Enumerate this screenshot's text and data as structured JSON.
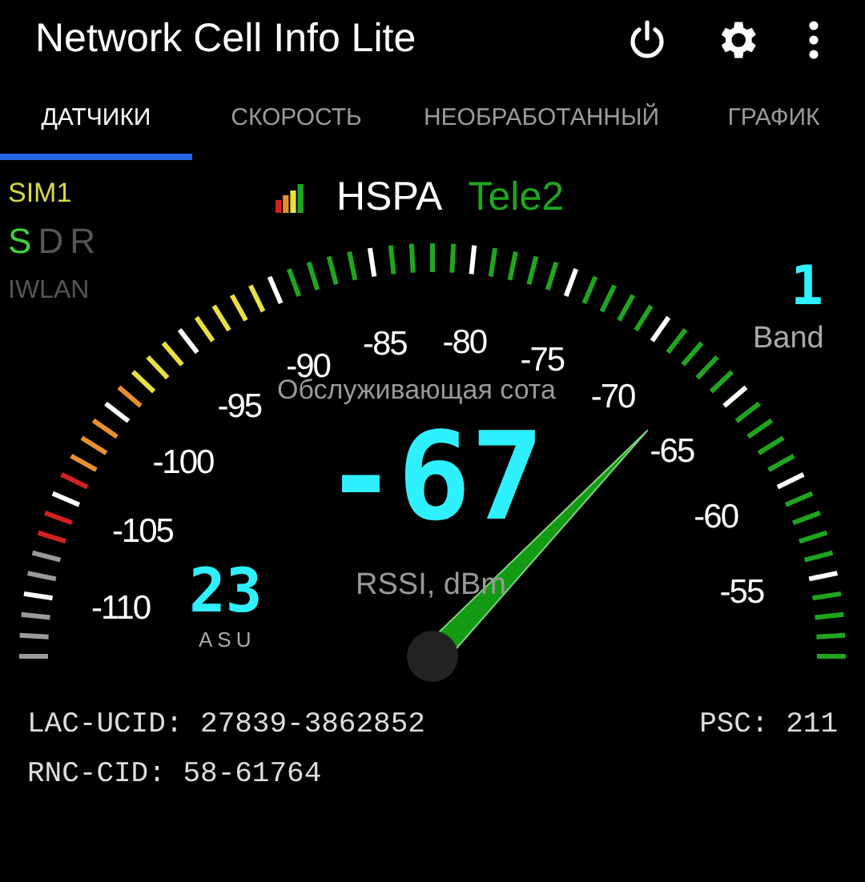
{
  "app_bar": {
    "title": "Network Cell Info Lite"
  },
  "tabs": [
    {
      "label": "ДАТЧИКИ",
      "selected": true
    },
    {
      "label": "СКОРОСТЬ",
      "selected": false
    },
    {
      "label": "НЕОБРАБОТАННЫЙ",
      "selected": false
    },
    {
      "label": "ГРАФИК",
      "selected": false
    }
  ],
  "sim": {
    "label": "SIM1",
    "modes": [
      {
        "label": "S",
        "on": true
      },
      {
        "label": "D",
        "on": false
      },
      {
        "label": "R",
        "on": false
      }
    ],
    "iwlan": {
      "label": "IWLAN",
      "on": false
    }
  },
  "network": {
    "type": "HSPA",
    "operator": "Tele2"
  },
  "band": {
    "value": "1",
    "label": "Band"
  },
  "gauge": {
    "caption": "Обслуживающая сота",
    "value": "-67",
    "unit": "RSSI, dBm",
    "scale_labels": [
      "-110",
      "-105",
      "-100",
      "-95",
      "-90",
      "-85",
      "-80",
      "-75",
      "-70",
      "-65",
      "-60",
      "-55"
    ]
  },
  "asu": {
    "value": "23",
    "label": "ASU"
  },
  "details": [
    {
      "text": "LAC-UCID: 27839-3862852"
    },
    {
      "text": "PSC: 211"
    },
    {
      "text": "RNC-CID: 58-61764"
    }
  ]
}
